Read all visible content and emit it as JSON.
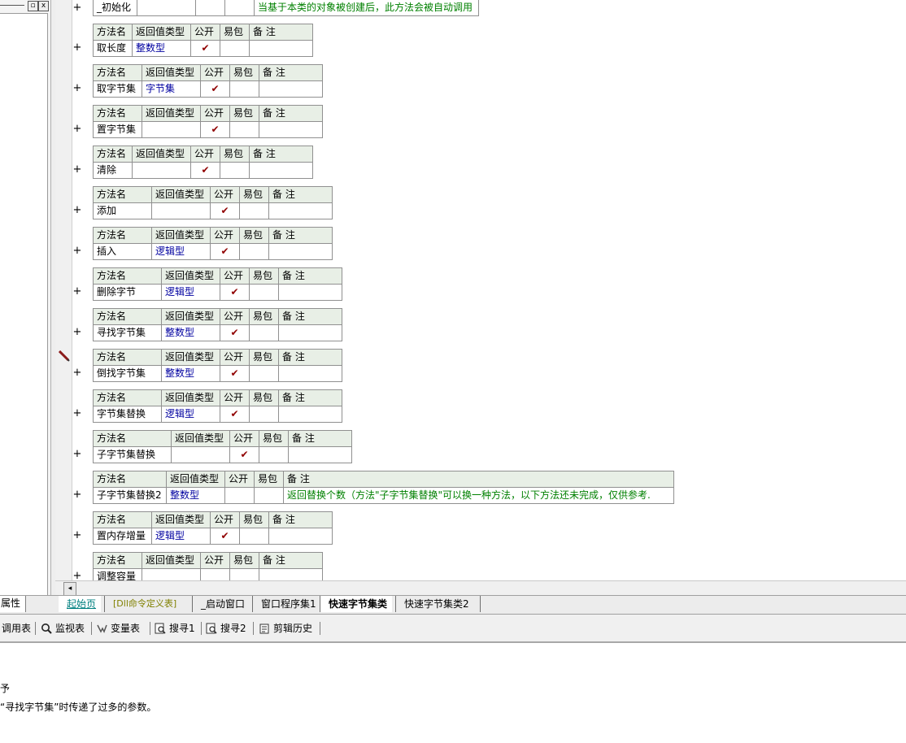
{
  "window": {
    "pin_symbol": "▫",
    "close_symbol": "x"
  },
  "header_labels": {
    "name": "方法名",
    "rettype": "返回值类型",
    "public": "公开",
    "easy": "易包",
    "note": "备 注"
  },
  "check_mark": "✔",
  "expand_symbol": "+",
  "top_row": {
    "name": "_初始化",
    "note": "当基于本类的对象被创建后，此方法会被自动调用"
  },
  "methods": [
    {
      "name": "取长度",
      "rettype": "整数型",
      "public": true,
      "note": ""
    },
    {
      "name": "取字节集",
      "rettype": "字节集",
      "public": true,
      "note": ""
    },
    {
      "name": "置字节集",
      "rettype": "",
      "public": true,
      "note": ""
    },
    {
      "name": "清除",
      "rettype": "",
      "public": true,
      "note": ""
    },
    {
      "name": "添加",
      "rettype": "",
      "public": true,
      "note": ""
    },
    {
      "name": "插入",
      "rettype": "逻辑型",
      "public": true,
      "note": ""
    },
    {
      "name": "删除字节",
      "rettype": "逻辑型",
      "public": true,
      "note": ""
    },
    {
      "name": "寻找字节集",
      "rettype": "整数型",
      "public": true,
      "note": ""
    },
    {
      "name": "倒找字节集",
      "rettype": "整数型",
      "public": true,
      "note": ""
    },
    {
      "name": "字节集替换",
      "rettype": "逻辑型",
      "public": true,
      "note": ""
    },
    {
      "name": "子字节集替换",
      "rettype": "",
      "public": true,
      "note": ""
    },
    {
      "name": "子字节集替换2",
      "rettype": "整数型",
      "public": false,
      "note": "返回替换个数（方法\"子字节集替换\"可以换一种方法，以下方法还未完成，仅供参考."
    },
    {
      "name": "置内存增量",
      "rettype": "逻辑型",
      "public": true,
      "note": ""
    },
    {
      "name": "调整容量",
      "rettype": "",
      "public": false,
      "note": ""
    }
  ],
  "tabs": {
    "attr": "属性",
    "items": [
      "起始页",
      "[Dll命令定义表]",
      "_启动窗口",
      "窗口程序集1",
      "快速字节集类",
      "快速字节集类2"
    ],
    "active_index": 4,
    "colors": {
      "start": "#008080",
      "dll": "#808000",
      "normal": "#000000"
    }
  },
  "toolbar": [
    "调用表",
    "监视表",
    "变量表",
    "搜寻1",
    "搜寻2",
    "剪辑历史"
  ],
  "output": {
    "line1": "予",
    "line2": "“寻找字节集”时传递了过多的参数。"
  }
}
